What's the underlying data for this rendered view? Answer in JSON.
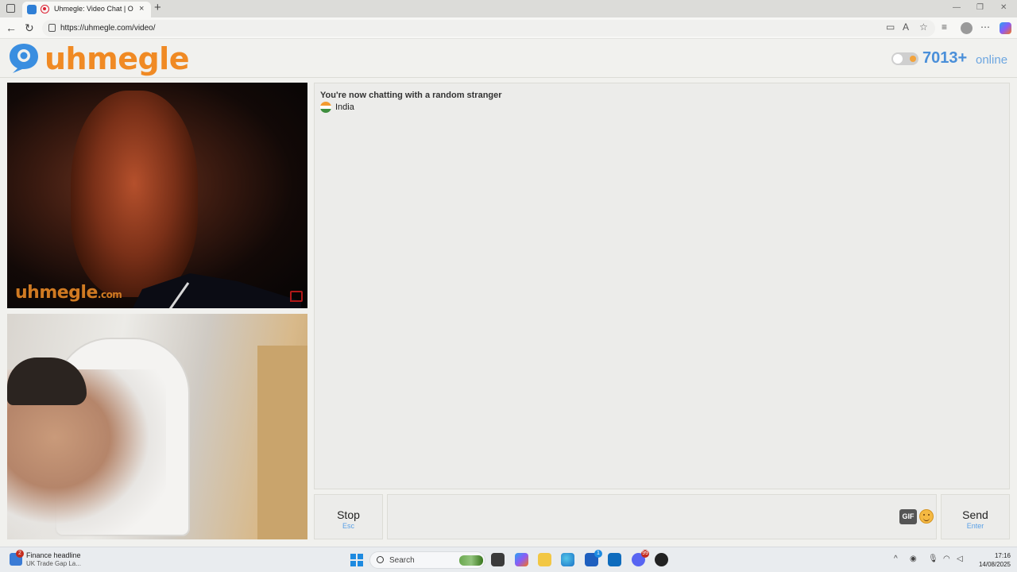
{
  "browser": {
    "tab_title": "Uhmegle: Video Chat | Omegle",
    "url": "https://uhmegle.com/video/",
    "new_tab_glyph": "+",
    "tab_close_glyph": "×",
    "window_controls": [
      "—",
      "❐",
      "✕"
    ]
  },
  "site": {
    "logo_text": "uhmegle",
    "online_count": "7013+",
    "online_label": "online"
  },
  "videos": {
    "stranger_watermark": "uhmegle",
    "stranger_watermark_suffix": ".com"
  },
  "chat": {
    "status_message": "You're now chatting with a random stranger",
    "stranger_country": "India",
    "flag_colors": [
      "#f39a2f",
      "#ffffff",
      "#3e8e3e"
    ]
  },
  "controls": {
    "stop_label": "Stop",
    "stop_hint": "Esc",
    "send_label": "Send",
    "send_hint": "Enter",
    "gif_label": "GIF",
    "input_value": ""
  },
  "taskbar": {
    "news_badge": "2",
    "news_title": "Finance headline",
    "news_subtitle": "UK Trade Gap La...",
    "search_placeholder": "Search",
    "store_badge": "1",
    "discord_badge": "99",
    "time": "17:16",
    "date": "14/08/2025"
  },
  "colors": {
    "brand_orange": "#f08a24",
    "brand_blue": "#4a8fd9",
    "hint_blue": "#5aa0e6"
  }
}
